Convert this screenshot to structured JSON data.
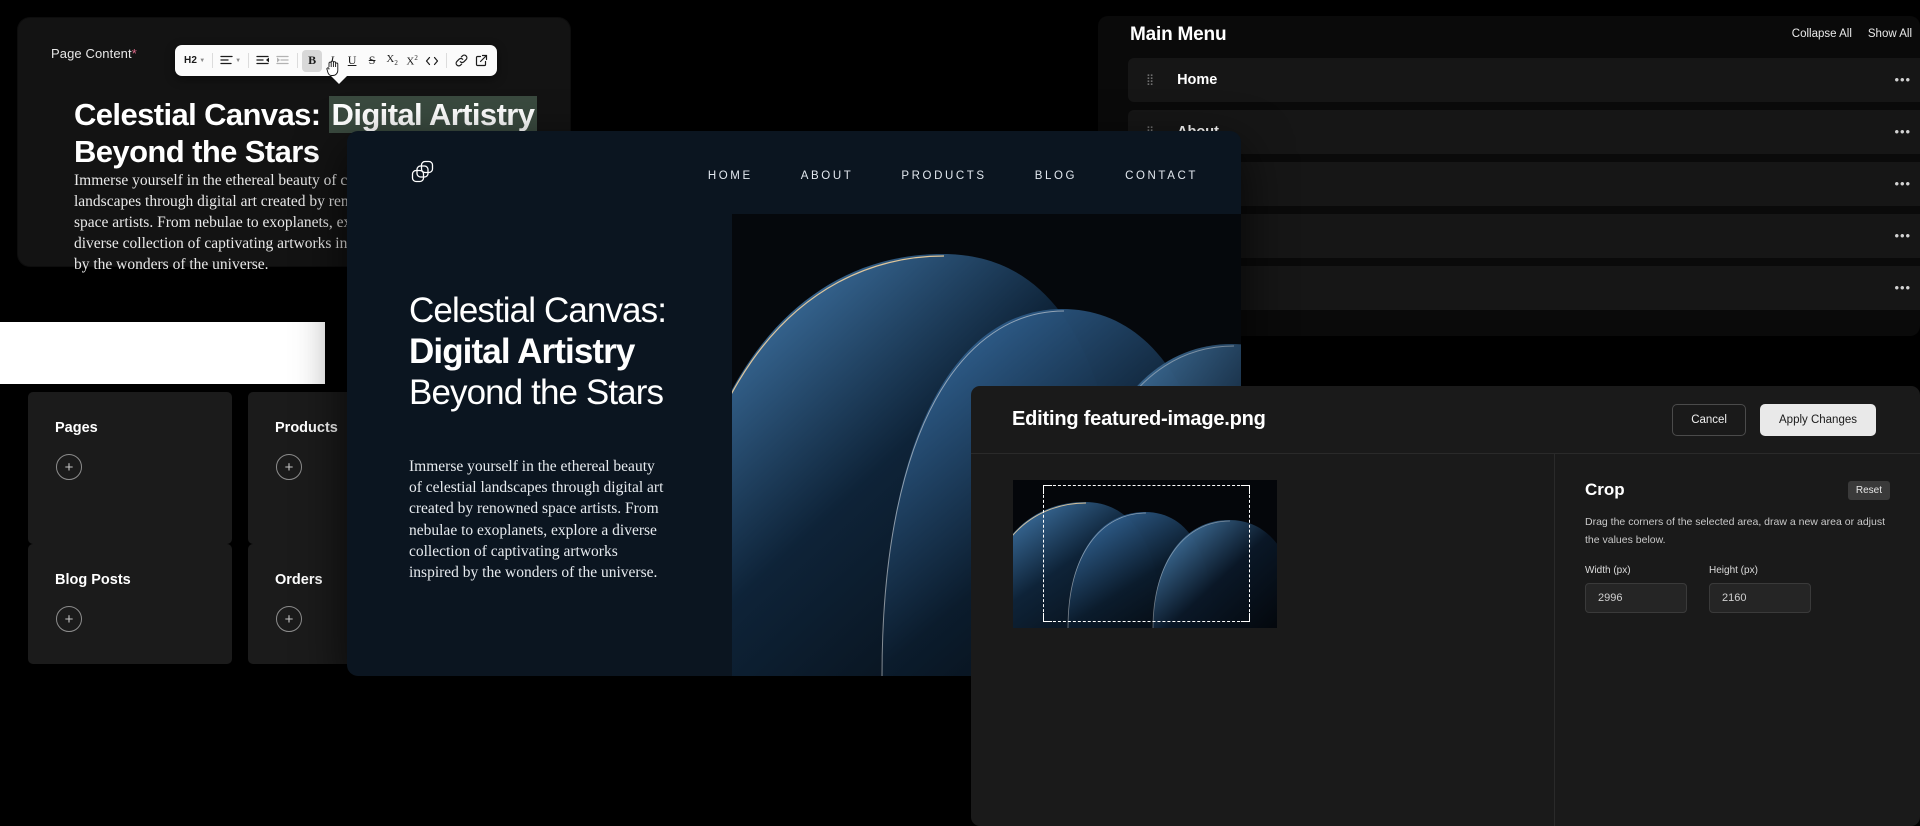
{
  "editor": {
    "label": "Page Content",
    "required_marker": "*",
    "toolbar": {
      "block_style": "H2",
      "items": [
        {
          "name": "block-style",
          "label": "H2",
          "type": "dropdown"
        },
        {
          "name": "align",
          "label": "align-left-icon",
          "type": "dropdown"
        },
        {
          "name": "indent-decrease",
          "label": "outdent-icon",
          "type": "icon"
        },
        {
          "name": "indent-increase",
          "label": "indent-icon",
          "type": "icon"
        },
        {
          "name": "bold",
          "label": "B",
          "type": "toggle",
          "active": true
        },
        {
          "name": "italic",
          "label": "I",
          "type": "toggle"
        },
        {
          "name": "underline",
          "label": "U",
          "type": "toggle"
        },
        {
          "name": "strikethrough",
          "label": "S",
          "type": "toggle"
        },
        {
          "name": "subscript",
          "label": "X2",
          "type": "toggle"
        },
        {
          "name": "superscript",
          "label": "X2",
          "type": "toggle"
        },
        {
          "name": "code",
          "label": "<>",
          "type": "toggle"
        },
        {
          "name": "link",
          "label": "link-icon",
          "type": "icon"
        },
        {
          "name": "external-link",
          "label": "external-link-icon",
          "type": "icon"
        }
      ]
    },
    "heading_part1": "Celestial Canvas: ",
    "heading_selected": "Digital Artistry",
    "heading_part2": "Beyond the Stars",
    "body": "Immerse yourself in the ethereal beauty of celestial landscapes through digital art created by renowned space artists. From nebulae to exoplanets, explore a diverse collection of captivating artworks inspired by the wonders of the universe.",
    "selection_color": "#3a4a3f"
  },
  "collections": {
    "cards": [
      {
        "title": "Pages",
        "add_icon": "+"
      },
      {
        "title": "Products",
        "add_icon": "+"
      },
      {
        "title": "Blog Posts",
        "add_icon": "+"
      },
      {
        "title": "Orders",
        "add_icon": "+"
      }
    ]
  },
  "main_menu": {
    "title": "Main Menu",
    "collapse_all": "Collapse All",
    "show_all": "Show All",
    "rows": [
      {
        "label": "Home",
        "grip": "⋮⋮",
        "more": "···",
        "chevron": "chevron-down"
      },
      {
        "label": "About",
        "grip": "⋮⋮",
        "more": "···",
        "chevron": "chevron-down"
      },
      {
        "label": "",
        "grip": "⋮⋮",
        "more": "···",
        "chevron": "chevron-down"
      },
      {
        "label": "",
        "grip": "⋮⋮",
        "more": "···",
        "chevron": "chevron-down"
      },
      {
        "label": "",
        "grip": "⋮⋮",
        "more": "···",
        "chevron": "chevron-down"
      }
    ]
  },
  "preview": {
    "logo": "overlapping-squares-logo",
    "nav": [
      "HOME",
      "ABOUT",
      "PRODUCTS",
      "BLOG",
      "CONTACT"
    ],
    "heading_line1": "Celestial Canvas:",
    "heading_line2": "Digital Artistry",
    "heading_line3": "Beyond the Stars",
    "body": "Immerse yourself in the ethereal beauty of celestial landscapes through digital art created by renowned space artists. From nebulae to exoplanets, explore a diverse collection of captivating artworks inspired by the wonders of the universe.",
    "background_color": "#0b1520"
  },
  "image_editor": {
    "title": "Editing featured-image.png",
    "cancel": "Cancel",
    "apply": "Apply Changes",
    "crop": {
      "title": "Crop",
      "reset": "Reset",
      "description": "Drag the corners of the selected area, draw a new area or adjust the values below.",
      "width_label": "Width (px)",
      "width_value": "2996",
      "height_label": "Height (px)",
      "height_value": "2160"
    }
  }
}
